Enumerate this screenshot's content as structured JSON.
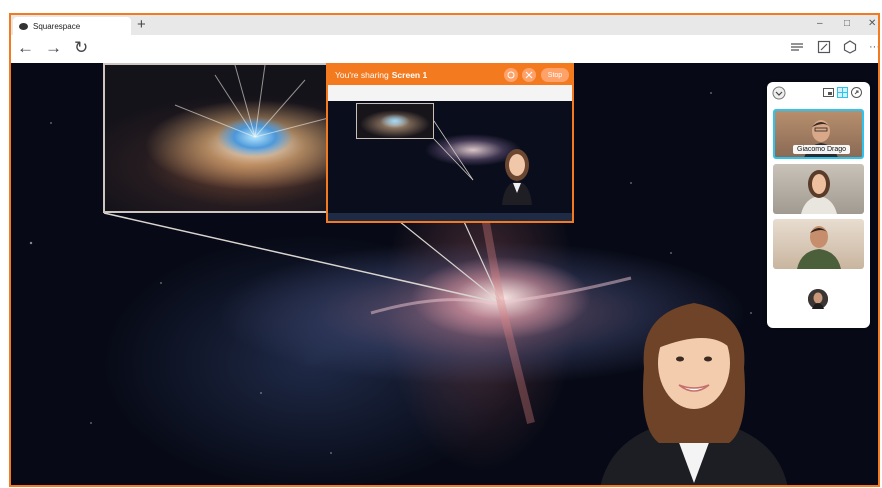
{
  "browser": {
    "tab_title": "Squarespace",
    "new_tab": "+",
    "window_controls": [
      "–",
      "□",
      "✕"
    ]
  },
  "toolbar": {
    "back_icon": "arrow-left-icon",
    "forward_icon": "arrow-right-icon",
    "reload_icon": "reload-icon",
    "right_icons": [
      "menu-icon",
      "edit-icon",
      "extensions-icon",
      "more-icon"
    ]
  },
  "sharing": {
    "prefix": "You're sharing",
    "screen": "Screen 1",
    "stop_label": "Stop",
    "accent": "#f47a20"
  },
  "panel": {
    "participant_name": "Giacomo Drago",
    "highlight": "#2ec4f0"
  }
}
